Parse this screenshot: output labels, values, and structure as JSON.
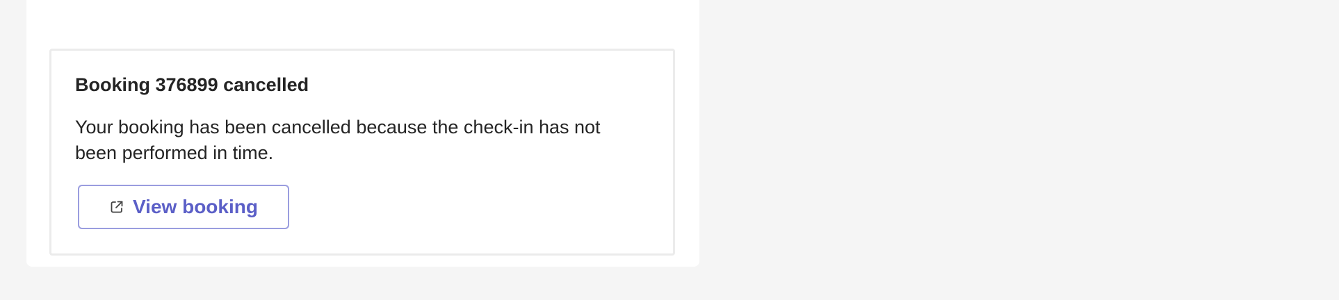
{
  "notification": {
    "title": "Booking 376899 cancelled",
    "message": "Your booking has been cancelled because the check-in has not been performed in time.",
    "button": {
      "label": "View booking",
      "icon": "external-link-icon"
    }
  },
  "colors": {
    "page_background": "#f5f5f5",
    "card_background": "#ffffff",
    "card_border": "#ebebeb",
    "text": "#242424",
    "accent": "#5b5fc7",
    "button_border": "#9a9ddf"
  }
}
